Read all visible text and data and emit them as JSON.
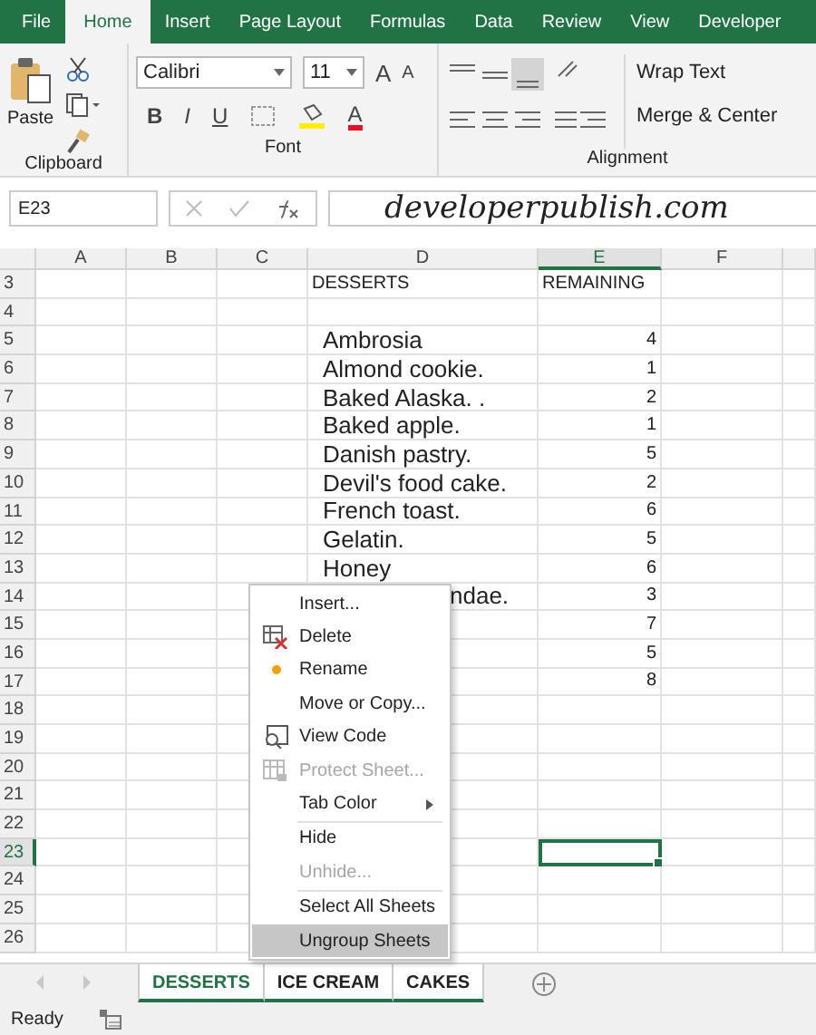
{
  "ribbon_tabs": [
    {
      "label": "File",
      "selected": false
    },
    {
      "label": "Home",
      "selected": true
    },
    {
      "label": "Insert",
      "selected": false
    },
    {
      "label": "Page Layout",
      "selected": false
    },
    {
      "label": "Formulas",
      "selected": false
    },
    {
      "label": "Data",
      "selected": false
    },
    {
      "label": "Review",
      "selected": false
    },
    {
      "label": "View",
      "selected": false
    },
    {
      "label": "Developer",
      "selected": false
    }
  ],
  "clipboard": {
    "paste": "Paste",
    "label": "Clipboard"
  },
  "font": {
    "name": "Calibri",
    "size": "11",
    "grow": "A",
    "shrink": "A",
    "bold": "B",
    "italic": "I",
    "underline": "U",
    "color_letter": "A",
    "color": "#e81123",
    "label": "Font"
  },
  "alignment": {
    "wrap_text": "Wrap Text",
    "merge": "Merge & Center",
    "label": "Alignment"
  },
  "name_box": "E23",
  "formula": "developerpublish.com",
  "columns": [
    {
      "label": "A",
      "selected": false
    },
    {
      "label": "B",
      "selected": false
    },
    {
      "label": "C",
      "selected": false
    },
    {
      "label": "D",
      "selected": false
    },
    {
      "label": "E",
      "selected": true
    },
    {
      "label": "F",
      "selected": false
    }
  ],
  "rows": [
    {
      "number": "3",
      "selected": false,
      "d": "DESSERTS",
      "e": "REMAINING",
      "kind": "header"
    },
    {
      "number": "4",
      "selected": false
    },
    {
      "number": "5",
      "selected": false,
      "d": "Ambrosia",
      "e": "4"
    },
    {
      "number": "6",
      "selected": false,
      "d": "Almond cookie.",
      "e": "1"
    },
    {
      "number": "7",
      "selected": false,
      "d": "Baked Alaska. .",
      "e": "2"
    },
    {
      "number": "8",
      "selected": false,
      "d": "Baked apple.",
      "e": "1"
    },
    {
      "number": "9",
      "selected": false,
      "d": "Danish pastry.",
      "e": "5"
    },
    {
      "number": "10",
      "selected": false,
      "d": "Devil's food cake.",
      "e": "2"
    },
    {
      "number": "11",
      "selected": false,
      "d": "French toast.",
      "e": "6"
    },
    {
      "number": "12",
      "selected": false,
      "d": "Gelatin.",
      "e": "5"
    },
    {
      "number": "13",
      "selected": false,
      "d": "Honey",
      "e": "6"
    },
    {
      "number": "14",
      "selected": false,
      "d": "ndae.",
      "e": "3",
      "kind": "covered"
    },
    {
      "number": "15",
      "selected": false,
      "e": "7"
    },
    {
      "number": "16",
      "selected": false,
      "e": "5"
    },
    {
      "number": "17",
      "selected": false,
      "e": "8"
    },
    {
      "number": "18",
      "selected": false
    },
    {
      "number": "19",
      "selected": false
    },
    {
      "number": "20",
      "selected": false
    },
    {
      "number": "21",
      "selected": false
    },
    {
      "number": "22",
      "selected": false
    },
    {
      "number": "23",
      "selected": true
    },
    {
      "number": "24",
      "selected": false
    },
    {
      "number": "25",
      "selected": false
    },
    {
      "number": "26",
      "selected": false
    }
  ],
  "context_menu": [
    {
      "label": "Insert...",
      "kind": "plain",
      "disabled": false,
      "highlighted": false
    },
    {
      "label": "Delete",
      "kind": "delete",
      "disabled": false,
      "highlighted": false
    },
    {
      "label": "Rename",
      "kind": "rename",
      "disabled": false,
      "highlighted": false
    },
    {
      "label": "Move or Copy...",
      "kind": "plain",
      "disabled": false,
      "highlighted": false
    },
    {
      "label": "View Code",
      "kind": "code",
      "disabled": false,
      "highlighted": false
    },
    {
      "label": "Protect Sheet...",
      "kind": "protect",
      "disabled": true,
      "highlighted": false
    },
    {
      "label": "Tab Color",
      "kind": "plain",
      "submenu": true,
      "disabled": false,
      "highlighted": false
    },
    {
      "label": "Hide",
      "kind": "plain",
      "separator_before": true,
      "disabled": false,
      "highlighted": false
    },
    {
      "label": "Unhide...",
      "kind": "plain",
      "disabled": true,
      "highlighted": false
    },
    {
      "label": "Select All Sheets",
      "kind": "plain",
      "separator_before": true,
      "disabled": false,
      "highlighted": false
    },
    {
      "label": "Ungroup Sheets",
      "kind": "plain",
      "disabled": false,
      "highlighted": true
    }
  ],
  "sheet_tabs": [
    {
      "label": "DESSERTS",
      "selected": true
    },
    {
      "label": "ICE CREAM",
      "selected": true
    },
    {
      "label": "CAKES",
      "selected": true
    }
  ],
  "status": "Ready"
}
